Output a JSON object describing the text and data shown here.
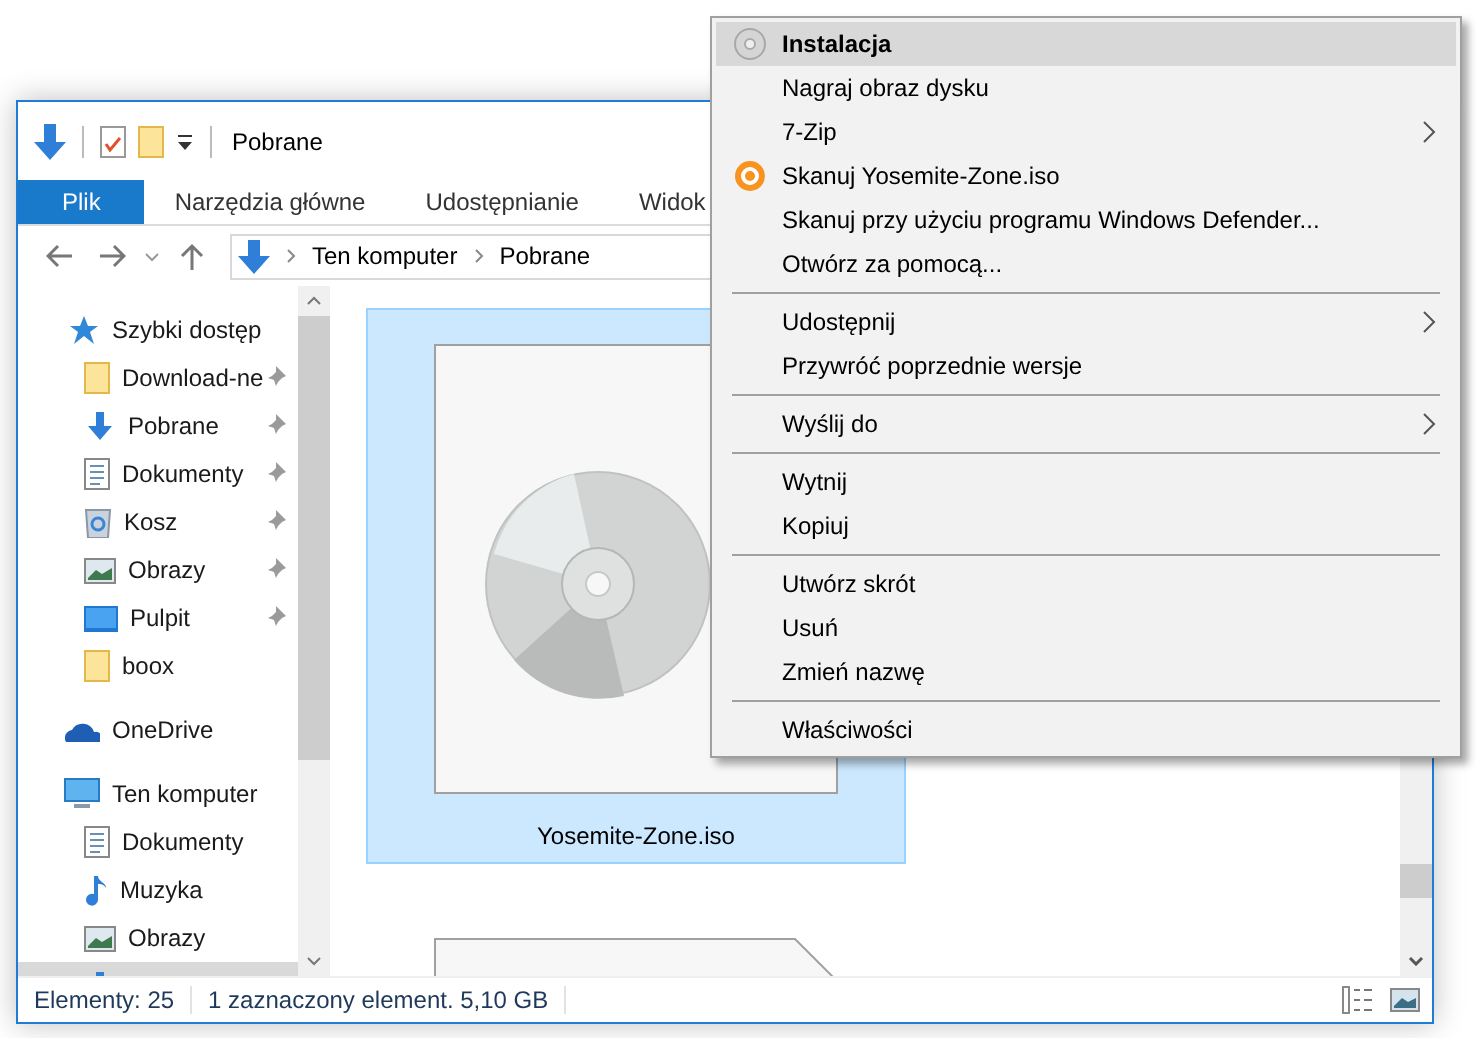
{
  "window": {
    "title": "Pobrane"
  },
  "ribbon_tabs": [
    {
      "label": "Plik",
      "selected": true
    },
    {
      "label": "Narzędzia główne",
      "selected": false
    },
    {
      "label": "Udostępnianie",
      "selected": false
    },
    {
      "label": "Widok",
      "selected": false
    }
  ],
  "address_bar": {
    "path": [
      "Ten komputer",
      "Pobrane"
    ]
  },
  "sidebar": {
    "items": [
      {
        "label": "Szybki dostęp",
        "kind": "star",
        "selected": false,
        "children": [
          {
            "label": "Download-ne",
            "kind": "folder",
            "pinned": true,
            "selected": false
          },
          {
            "label": "Pobrane",
            "kind": "download",
            "pinned": true,
            "selected": false
          },
          {
            "label": "Dokumenty",
            "kind": "document",
            "pinned": true,
            "selected": false
          },
          {
            "label": "Kosz",
            "kind": "bin",
            "pinned": true,
            "selected": false
          },
          {
            "label": "Obrazy",
            "kind": "image",
            "pinned": true,
            "selected": false
          },
          {
            "label": "Pulpit",
            "kind": "desktop",
            "pinned": true,
            "selected": false
          },
          {
            "label": "boox",
            "kind": "folder",
            "pinned": false,
            "selected": false
          }
        ]
      },
      {
        "label": "OneDrive",
        "kind": "cloud",
        "selected": false
      },
      {
        "label": "Ten komputer",
        "kind": "computer",
        "selected": false,
        "children": [
          {
            "label": "Dokumenty",
            "kind": "document",
            "pinned": false,
            "selected": false
          },
          {
            "label": "Muzyka",
            "kind": "music",
            "pinned": false,
            "selected": false
          },
          {
            "label": "Obrazy",
            "kind": "image",
            "pinned": false,
            "selected": false
          },
          {
            "kind": "download",
            "pinned": false,
            "selected": true
          }
        ]
      }
    ]
  },
  "files": [
    {
      "label": "Yosemite-Zone.iso",
      "kind": "disc",
      "selected": true
    },
    {
      "kind": "blank",
      "selected": false
    }
  ],
  "status_bar": {
    "count": "Elementy: 25",
    "selection": "1 zaznaczony element. 5,10 GB"
  },
  "context_menu": {
    "groups": [
      [
        {
          "label": "Instalacja",
          "kind": "disc",
          "default": true,
          "selected": true,
          "submenu": false
        },
        {
          "label": "Nagraj obraz dysku",
          "kind": "plain",
          "default": false,
          "selected": false,
          "submenu": false
        },
        {
          "label": "7-Zip",
          "kind": "plain",
          "default": false,
          "selected": false,
          "submenu": true
        },
        {
          "label": "Skanuj Yosemite-Zone.iso",
          "kind": "scanner",
          "default": false,
          "selected": false,
          "submenu": false
        },
        {
          "label": "Skanuj przy użyciu programu Windows Defender...",
          "kind": "plain",
          "default": false,
          "selected": false,
          "submenu": false
        },
        {
          "label": "Otwórz za pomocą...",
          "kind": "plain",
          "default": false,
          "selected": false,
          "submenu": false
        }
      ],
      [
        {
          "label": "Udostępnij",
          "kind": "plain",
          "default": false,
          "selected": false,
          "submenu": true
        },
        {
          "label": "Przywróć poprzednie wersje",
          "kind": "plain",
          "default": false,
          "selected": false,
          "submenu": false
        }
      ],
      [
        {
          "label": "Wyślij do",
          "kind": "plain",
          "default": false,
          "selected": false,
          "submenu": true
        }
      ],
      [
        {
          "label": "Wytnij",
          "kind": "plain",
          "default": false,
          "selected": false,
          "submenu": false
        },
        {
          "label": "Kopiuj",
          "kind": "plain",
          "default": false,
          "selected": false,
          "submenu": false
        }
      ],
      [
        {
          "label": "Utwórz skrót",
          "kind": "plain",
          "default": false,
          "selected": false,
          "submenu": false
        },
        {
          "label": "Usuń",
          "kind": "plain",
          "default": false,
          "selected": false,
          "submenu": false
        },
        {
          "label": "Zmień nazwę",
          "kind": "plain",
          "default": false,
          "selected": false,
          "submenu": false
        }
      ],
      [
        {
          "label": "Właściwości",
          "kind": "plain",
          "default": false,
          "selected": false,
          "submenu": false
        }
      ]
    ]
  }
}
